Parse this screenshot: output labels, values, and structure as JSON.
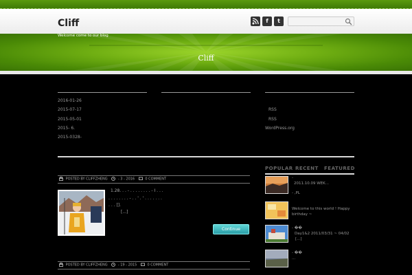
{
  "header": {
    "logo": "Cliff",
    "tagline": "Welcome come to our blog",
    "search_placeholder": ""
  },
  "social": [
    {
      "icon": "rss-icon",
      "glyph": "◉"
    },
    {
      "icon": "facebook-icon",
      "glyph": "f"
    },
    {
      "icon": "twitter-icon",
      "glyph": "t"
    }
  ],
  "banner": {
    "title": "Cliff"
  },
  "archives": [
    "2016-01-26",
    "2015-07-17",
    "2015-05-01",
    "2015- 6.",
    "2015-0328-"
  ],
  "meta_widget": [
    "RSS",
    "RSS",
    "WordPress.org"
  ],
  "posts": [
    {
      "meta_author": "POSTED BY CLIFFZHENG",
      "meta_date": "- 3 - 2016",
      "meta_comment": "0 COMMENT",
      "excerpt_lines": [
        "1.28. . .   -  . . . . . . . .  -  I . . .",
        ". . . . . . . .   -   . .  ' .  ' . . . . .  . .",
        ". . .         [].",
        "[...]"
      ],
      "continue_label": "Continue"
    },
    {
      "meta_author": "POSTED BY CLIFFZHENG",
      "meta_date": "- 19 - 2015",
      "meta_comment": "0 COMMENT"
    }
  ],
  "tabs": [
    "POPULAR",
    "RECENT",
    "FEATURED"
  ],
  "sidebar_posts": [
    {
      "line1": "-",
      "line2": "2011.10.09 WEK...",
      "line3": "- ,PL"
    },
    {
      "line1": "Welcome to this world ! Happy",
      "line2": "birthday ~"
    },
    {
      "line1": "- ��",
      "line2": "Day1&2 2011/03/31 ~ 04/02",
      "line3": "[...]"
    },
    {
      "line1": "- ��",
      "line2": "..."
    }
  ],
  "colors": {
    "accent_green": "#5a9a0e",
    "button_teal": "#2a9da7"
  }
}
